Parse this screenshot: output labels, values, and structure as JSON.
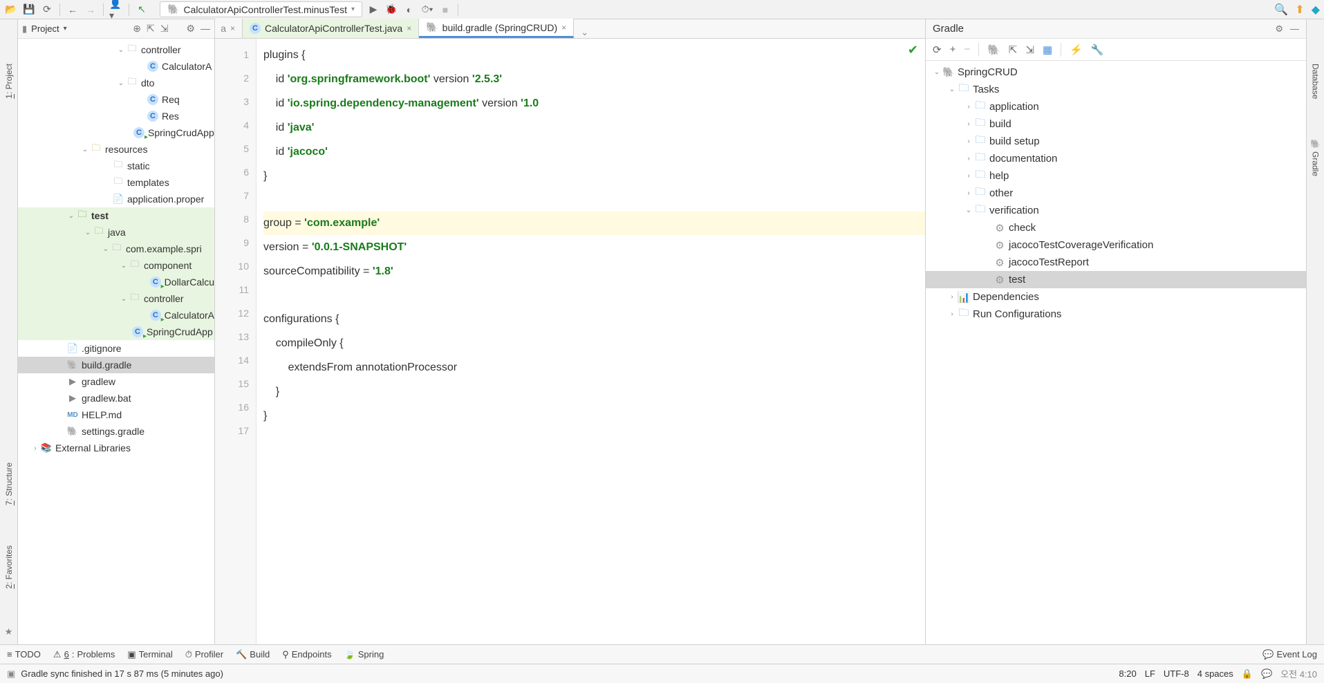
{
  "toolbar": {
    "run_config": "CalculatorApiControllerTest.minusTest"
  },
  "left_rail": {
    "project": {
      "num": "1",
      "label": ": Project"
    },
    "structure": {
      "num": "7",
      "label": ": Structure"
    },
    "favorites": {
      "num": "2",
      "label": ": Favorites"
    }
  },
  "right_rail": {
    "database": "Database",
    "gradle": "Gradle"
  },
  "project_panel": {
    "title": "Project",
    "tree": {
      "controller": "controller",
      "calculatorA": "CalculatorA",
      "dto": "dto",
      "req": "Req",
      "res": "Res",
      "springCrudApp": "SpringCrudApp",
      "resources": "resources",
      "static": "static",
      "templates": "templates",
      "appProps": "application.proper",
      "test": "test",
      "java": "java",
      "comExample": "com.example.spri",
      "component": "component",
      "dollarCalcu": "DollarCalcu",
      "controller2": "controller",
      "calculatorA2": "CalculatorA",
      "springCrudApp2": "SpringCrudApp",
      "gitignore": ".gitignore",
      "buildGradle": "build.gradle",
      "gradlew": "gradlew",
      "gradlewBat": "gradlew.bat",
      "helpMd": "HELP.md",
      "settingsGradle": "settings.gradle",
      "externalLibs": "External Libraries"
    }
  },
  "tabs": {
    "partial": "a",
    "tab1": "CalculatorApiControllerTest.java",
    "tab2": "build.gradle (SpringCRUD)"
  },
  "code": {
    "lines": [
      "1",
      "2",
      "3",
      "4",
      "5",
      "6",
      "7",
      "8",
      "9",
      "10",
      "11",
      "12",
      "13",
      "14",
      "15",
      "16",
      "17"
    ],
    "l1a": "plugins {",
    "l2a": "    id ",
    "l2b": "'org.springframework.boot'",
    "l2c": " version ",
    "l2d": "'2.5.3'",
    "l3a": "    id ",
    "l3b": "'io.spring.dependency-management'",
    "l3c": " version ",
    "l3d": "'1.0",
    "l4a": "    id ",
    "l4b": "'java'",
    "l5a": "    id ",
    "l5b": "'jacoco'",
    "l6a": "}",
    "l8a": "group = ",
    "l8b": "'com.example'",
    "l9a": "version = ",
    "l9b": "'0.0.1-SNAPSHOT'",
    "l10a": "sourceCompatibility = ",
    "l10b": "'1.8'",
    "l12a": "configurations {",
    "l13a": "    compileOnly {",
    "l14a": "        extendsFrom annotationProcessor",
    "l15a": "    }",
    "l16a": "}"
  },
  "gradle": {
    "title": "Gradle",
    "root": "SpringCRUD",
    "tasks": "Tasks",
    "application": "application",
    "build": "build",
    "buildSetup": "build setup",
    "documentation": "documentation",
    "help": "help",
    "other": "other",
    "verification": "verification",
    "check": "check",
    "jacocoVerif": "jacocoTestCoverageVerification",
    "jacocoReport": "jacocoTestReport",
    "test": "test",
    "dependencies": "Dependencies",
    "runConfigs": "Run Configurations"
  },
  "bottom": {
    "todo": "TODO",
    "problems": "Problems",
    "problemsNum": "6",
    "terminal": "Terminal",
    "profiler": "Profiler",
    "build": "Build",
    "endpoints": "Endpoints",
    "spring": "Spring",
    "eventLog": "Event Log"
  },
  "status": {
    "msg": "Gradle sync finished in 17 s 87 ms (5 minutes ago)",
    "pos": "8:20",
    "lf": "LF",
    "enc": "UTF-8",
    "indent": "4 spaces",
    "clock": "오전 4:10"
  }
}
